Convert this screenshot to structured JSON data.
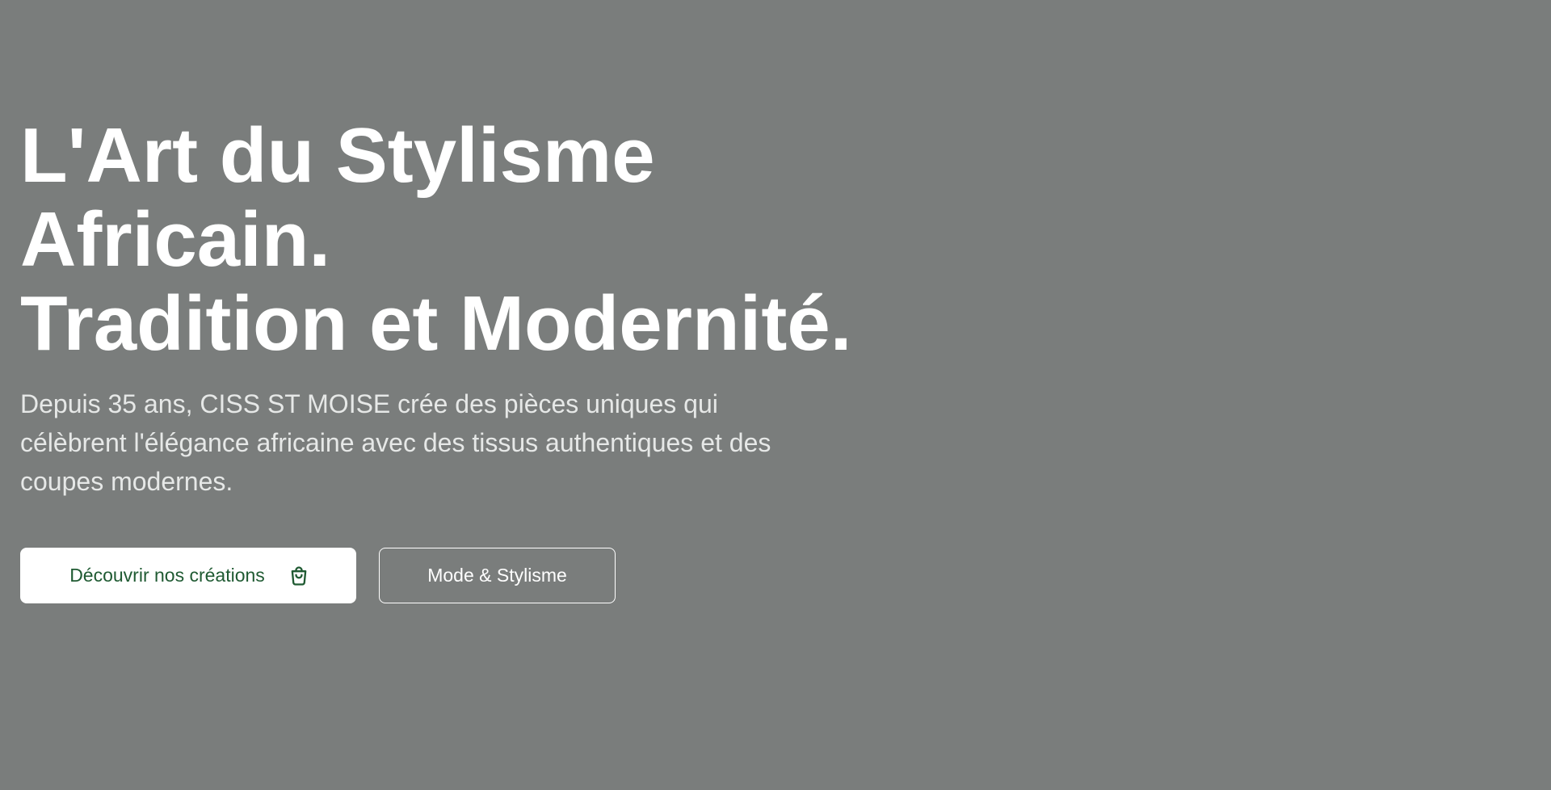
{
  "hero": {
    "title_lines": [
      "L'Art du Stylisme",
      "Africain.",
      "Tradition et Modernité."
    ],
    "description": "Depuis 35 ans, CISS ST MOISE crée des pièces uniques qui célèbrent l'élégance africaine avec des tissus authentiques et des coupes modernes.",
    "primary_button": {
      "label": "Découvrir nos créations",
      "icon": "shopping-bag-icon"
    },
    "secondary_button": {
      "label": "Mode & Stylisme"
    }
  },
  "colors": {
    "background": "#7a7d7c",
    "primary_text": "#ffffff",
    "accent_green": "#1f5a32"
  }
}
